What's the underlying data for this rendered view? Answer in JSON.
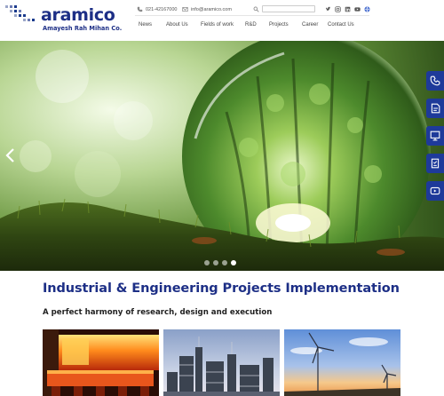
{
  "brand": {
    "name": "aramico",
    "tagline": "Amayesh Rah Mihan Co."
  },
  "contact": {
    "phone": "021-42167000",
    "email": "info@aramico.com"
  },
  "search": {
    "placeholder": ""
  },
  "social_icons": [
    "twitter-icon",
    "instagram-icon",
    "linkedin-icon",
    "youtube-icon"
  ],
  "language_icon": "globe-icon",
  "nav": {
    "items": [
      {
        "label": "News"
      },
      {
        "label": "About Us"
      },
      {
        "label": "Fields of work"
      },
      {
        "label": "R&D"
      },
      {
        "label": "Projects"
      },
      {
        "label": "Career"
      },
      {
        "label": "Contact Us"
      }
    ]
  },
  "hero": {
    "slide_count": 4,
    "active_slide": 4,
    "prev_icon": "chevron-left-icon"
  },
  "side_actions": [
    "phone-icon",
    "document-icon",
    "presentation-icon",
    "survey-icon",
    "video-icon"
  ],
  "section": {
    "title": "Industrial & Engineering Projects Implementation",
    "subtitle": "A perfect harmony of research, design and execution"
  },
  "cards": [
    {
      "subject": "furnace-steel"
    },
    {
      "subject": "refinery-plant"
    },
    {
      "subject": "wind-turbines"
    }
  ],
  "colors": {
    "brand_blue": "#1d2f86",
    "rail_blue": "#1e3a9a"
  }
}
